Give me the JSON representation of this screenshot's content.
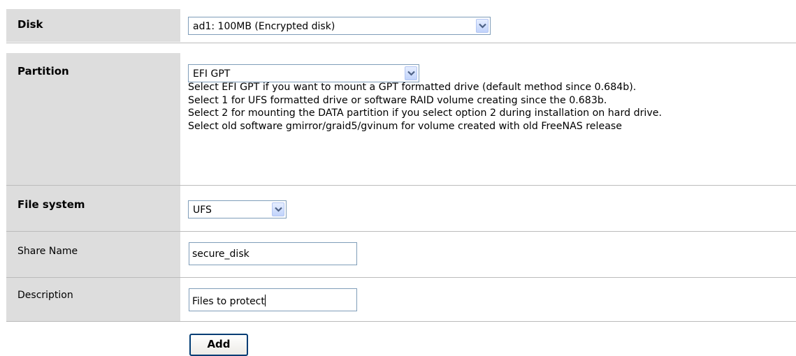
{
  "form": {
    "disk": {
      "label": "Disk",
      "selected": "ad1: 100MB (Encrypted disk)"
    },
    "partition": {
      "label": "Partition",
      "selected": "EFI GPT",
      "help": [
        "Select EFI GPT if you want to mount a GPT formatted drive (default method since 0.684b).",
        "Select 1 for UFS formatted drive or software RAID volume creating since the 0.683b.",
        "Select 2 for mounting the DATA partition if you select option 2 during installation on hard drive.",
        "Select old software gmirror/graid5/gvinum for volume created with old FreeNAS release"
      ]
    },
    "file_system": {
      "label": "File system",
      "selected": "UFS"
    },
    "share_name": {
      "label": "Share Name",
      "value": "secure_disk"
    },
    "description": {
      "label": "Description",
      "value": "Files to protect"
    },
    "add_button_label": "Add"
  },
  "icons": {
    "dropdown": "chevron-down-icon"
  },
  "colors": {
    "label_background": "#dddddd",
    "input_border": "#7f9db9",
    "dropdown_arrow": "#4d6185"
  }
}
